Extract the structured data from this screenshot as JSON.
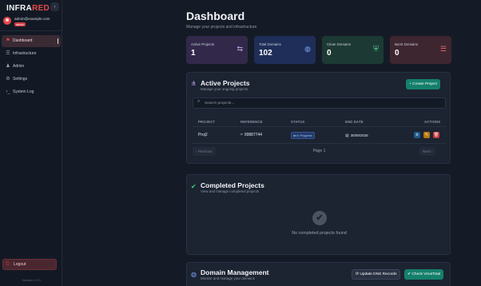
{
  "brand": {
    "part1": "INFRA",
    "part2": "RED"
  },
  "sidebar": {
    "collapse_glyph": "‹",
    "user": {
      "email": "admin@example.com",
      "role": "admin"
    },
    "items": [
      {
        "label": "Dashboard",
        "icon": "dashboard-icon",
        "glyph": "⚑",
        "active": true
      },
      {
        "label": "Infrastructure",
        "icon": "server-icon",
        "glyph": "☰",
        "active": false
      },
      {
        "label": "Admin",
        "icon": "user-shield-icon",
        "glyph": "♟",
        "active": false
      },
      {
        "label": "Settings",
        "icon": "gear-icon",
        "glyph": "⚙",
        "active": false
      },
      {
        "label": "System Log",
        "icon": "terminal-icon",
        "glyph": "›_",
        "active": false
      }
    ],
    "logout": {
      "label": "Logout",
      "glyph": "⎋"
    },
    "version": "Version 1.0.0"
  },
  "header": {
    "title": "Dashboard",
    "subtitle": "Manage your projects and infrastructure"
  },
  "stats": [
    {
      "label": "Active Projects",
      "value": "1",
      "icon": "project-diagram-icon",
      "glyph": "⇆"
    },
    {
      "label": "Total Domains",
      "value": "102",
      "icon": "globe-icon",
      "glyph": "◍"
    },
    {
      "label": "Clean Domains",
      "value": "0",
      "icon": "shield-icon",
      "glyph": "⛨"
    },
    {
      "label": "Burnt Domains",
      "value": "0",
      "icon": "list-icon",
      "glyph": "☰"
    }
  ],
  "active_projects": {
    "title": "Active Projects",
    "subtitle": "Manage your ongoing projects",
    "icon_glyph": "⋔",
    "create_button": "+ Create Project",
    "search_placeholder": "Search projects...",
    "search_glyph": "⌕",
    "columns": [
      "PROJECT",
      "REFERENCE",
      "STATUS",
      "END DATE",
      "ACTIONS"
    ],
    "rows": [
      {
        "project": "Proj2",
        "reference": "99887744",
        "status": "⇄ In Progress",
        "end_date": "30/09/2026",
        "ref_glyph": "⌗",
        "date_glyph": "▦"
      }
    ],
    "action_glyphs": {
      "view": "⋔",
      "edit": "✎",
      "delete": "🗑"
    },
    "pagination": {
      "previous": "‹ Previous",
      "page": "Page 1",
      "next": "Next ›"
    }
  },
  "completed_projects": {
    "title": "Completed Projects",
    "subtitle": "View and manage completed projects",
    "icon_glyph": "✔",
    "empty_glyph": "✔",
    "empty_text": "No completed projects found"
  },
  "domain_management": {
    "title": "Domain Management",
    "subtitle": "Monitor and manage your domains",
    "icon_glyph": "◍",
    "update_button": "⟳ Update DNS Records",
    "check_button": "✔ Check VirusTotal"
  },
  "colors": {
    "accent": "#e5484d",
    "primary_button": "#15806b",
    "background": "#151b26",
    "card": "#1c2331"
  }
}
